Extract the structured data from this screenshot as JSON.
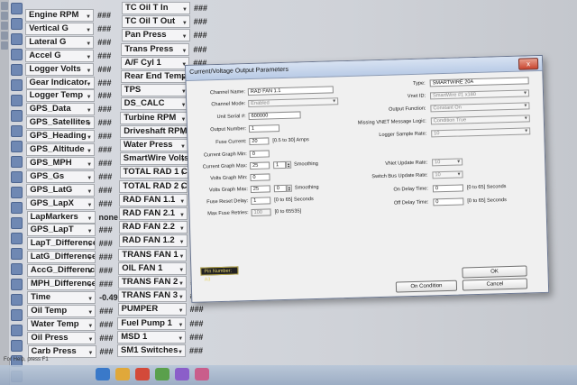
{
  "left_column": {
    "items": [
      {
        "label": "Engine RPM",
        "value": "###"
      },
      {
        "label": "Vertical G",
        "value": "###"
      },
      {
        "label": "Lateral G",
        "value": "###"
      },
      {
        "label": "Accel G",
        "value": "###"
      },
      {
        "label": "Logger Volts",
        "value": "###"
      },
      {
        "label": "Gear Indicator",
        "value": "###"
      },
      {
        "label": "Logger Temp",
        "value": "###"
      },
      {
        "label": "GPS_Data",
        "value": "###"
      },
      {
        "label": "GPS_Satellites",
        "value": "###"
      },
      {
        "label": "GPS_Heading",
        "value": "###"
      },
      {
        "label": "GPS_Altitude",
        "value": "###"
      },
      {
        "label": "GPS_MPH",
        "value": "###"
      },
      {
        "label": "GPS_Gs",
        "value": "###"
      },
      {
        "label": "GPS_LatG",
        "value": "###"
      },
      {
        "label": "GPS_LapX",
        "value": "###"
      },
      {
        "label": "LapMarkers",
        "value": "none"
      },
      {
        "label": "GPS_LapT",
        "value": "###"
      },
      {
        "label": "LapT_Difference",
        "value": "###"
      },
      {
        "label": "LatG_Difference",
        "value": "###"
      },
      {
        "label": "AccG_Difference",
        "value": "###"
      },
      {
        "label": "MPH_Difference",
        "value": "###"
      },
      {
        "label": "Time",
        "value": "-0.49"
      },
      {
        "label": "Oil Temp",
        "value": "###"
      },
      {
        "label": "Water Temp",
        "value": "###"
      },
      {
        "label": "Oil Press",
        "value": "###"
      },
      {
        "label": "Carb Press",
        "value": "###"
      }
    ]
  },
  "right_column": {
    "items": [
      {
        "label": "TC Oil T In",
        "value": "###"
      },
      {
        "label": "TC Oil T Out",
        "value": "###"
      },
      {
        "label": "Pan Press",
        "value": "###"
      },
      {
        "label": "Trans Press",
        "value": "###"
      },
      {
        "label": "A/F Cyl 1",
        "value": "###"
      },
      {
        "label": "Rear End Temp",
        "value": "###"
      },
      {
        "label": "TPS",
        "value": "###"
      },
      {
        "label": "DS_CALC",
        "value": "###"
      },
      {
        "label": "Turbine RPM",
        "value": "###"
      },
      {
        "label": "Driveshaft RPM",
        "value": "###"
      },
      {
        "label": "Water Press",
        "value": "###"
      },
      {
        "label": "SmartWire Volts",
        "value": "###"
      },
      {
        "label": "TOTAL RAD 1 CUR",
        "value": "###"
      },
      {
        "label": "TOTAL RAD 2 CUR",
        "value": "###"
      },
      {
        "label": "RAD FAN 1.1",
        "value": "###"
      },
      {
        "label": "RAD FAN 2.1",
        "value": "###"
      },
      {
        "label": "RAD FAN 2.2",
        "value": "###"
      },
      {
        "label": "RAD FAN 1.2",
        "value": "###"
      },
      {
        "label": "TRANS FAN 1",
        "value": "###"
      },
      {
        "label": "OIL FAN 1",
        "value": "###"
      },
      {
        "label": "TRANS FAN 2",
        "value": "###"
      },
      {
        "label": "TRANS FAN 3",
        "value": "###"
      },
      {
        "label": "PUMPER",
        "value": "###"
      },
      {
        "label": "Fuel Pump 1",
        "value": "###"
      },
      {
        "label": "MSD 1",
        "value": "###"
      },
      {
        "label": "SM1 Switches",
        "value": "###"
      }
    ]
  },
  "dialog": {
    "title": "Current/Voltage Output Parameters",
    "close_glyph": "x",
    "fields": {
      "channel_name": {
        "label": "Channel Name:",
        "value": "RAD FAN 1.1"
      },
      "channel_mode": {
        "label": "Channel Mode:",
        "value": "Enabled"
      },
      "unit_serial": {
        "label": "Unit Serial #:",
        "value": "600000"
      },
      "output_number": {
        "label": "Output Number:",
        "value": "1"
      },
      "fuse_current": {
        "label": "Fuse Current:",
        "value": "20",
        "hint": "[0.5 to 30] Amps"
      },
      "current_graph_min": {
        "label": "Current Graph Min:",
        "value": "0"
      },
      "current_graph_max": {
        "label": "Current Graph Max:",
        "value": "25",
        "smoothing": "1",
        "smoothing_label": "Smoothing"
      },
      "volts_graph_min": {
        "label": "Volts Graph Min:",
        "value": "0"
      },
      "volts_graph_max": {
        "label": "Volts Graph Max:",
        "value": "25",
        "smoothing": "0",
        "smoothing_label": "Smoothing"
      },
      "fuse_reset_delay": {
        "label": "Fuse Reset Delay:",
        "value": "1",
        "hint": "[0 to 65] Seconds"
      },
      "max_fuse_retries": {
        "label": "Max Fuse Retries:",
        "value": "100",
        "hint": "[0 to 65535]"
      },
      "type": {
        "label": "Type:",
        "value": "SMARTWIRE 20A"
      },
      "vnet_id": {
        "label": "Vnet ID:",
        "value": "SmartWire #1 x180"
      },
      "output_function": {
        "label": "Output Function:",
        "value": "Constant On"
      },
      "missing_vnet_logic": {
        "label": "Missing VNET Message Logic:",
        "value": "Condition True"
      },
      "logger_sample_rate": {
        "label": "Logger Sample Rate:",
        "value": "10"
      },
      "vnet_update_rate": {
        "label": "VNet Update Rate:",
        "value": "10"
      },
      "switch_bus_update_rate": {
        "label": "Switch Bus Update Rate:",
        "value": "10"
      },
      "on_delay_time": {
        "label": "On Delay Time:",
        "value": "0",
        "hint": "[0 to 65] Seconds"
      },
      "off_delay_time": {
        "label": "Off Delay Time:",
        "value": "0",
        "hint": "[0 to 65] Seconds"
      }
    },
    "pin_number": "Pin Number: A3",
    "buttons": {
      "ok": "OK",
      "on_condition": "On Condition",
      "cancel": "Cancel"
    }
  },
  "status_bar": {
    "text": "For Help, press F1"
  }
}
